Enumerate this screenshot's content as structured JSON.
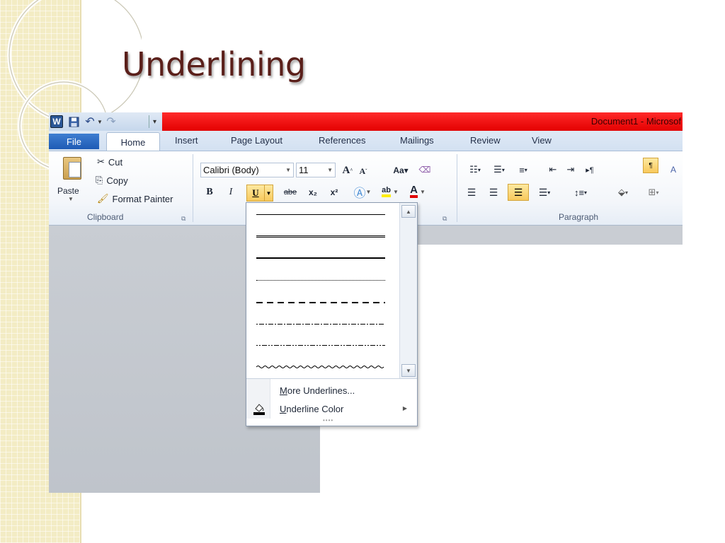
{
  "slide": {
    "title": "Underlining"
  },
  "window": {
    "title": "Document1  -  Microsof",
    "title_bar_color": "#e30000"
  },
  "qat": {
    "word_icon": "W"
  },
  "tabs": {
    "file": "File",
    "home": "Home",
    "insert": "Insert",
    "page_layout": "Page Layout",
    "references": "References",
    "mailings": "Mailings",
    "review": "Review",
    "view": "View"
  },
  "ribbon": {
    "clipboard": {
      "paste": "Paste",
      "cut": "Cut",
      "copy": "Copy",
      "format_painter": "Format Painter",
      "group_label": "Clipboard"
    },
    "font": {
      "font_name": "Calibri (Body)",
      "font_size": "11",
      "bold": "B",
      "italic": "I",
      "underline": "U",
      "strikethrough": "abe",
      "subscript": "x₂",
      "superscript": "x²",
      "change_case": "Aa",
      "highlight": "ab",
      "font_color": "A"
    },
    "paragraph": {
      "group_label": "Paragraph"
    }
  },
  "underline_menu": {
    "styles": [
      "single",
      "double",
      "thick",
      "dotted",
      "dashed",
      "dot-dash",
      "dot-dot-dash",
      "wave"
    ],
    "more_underlines": "More Underlines...",
    "underline_color": "Underline Color"
  },
  "colors": {
    "accent_highlight": "#f8c95c",
    "file_tab": "#1e5bb5",
    "title_text": "#5a1f1a"
  }
}
